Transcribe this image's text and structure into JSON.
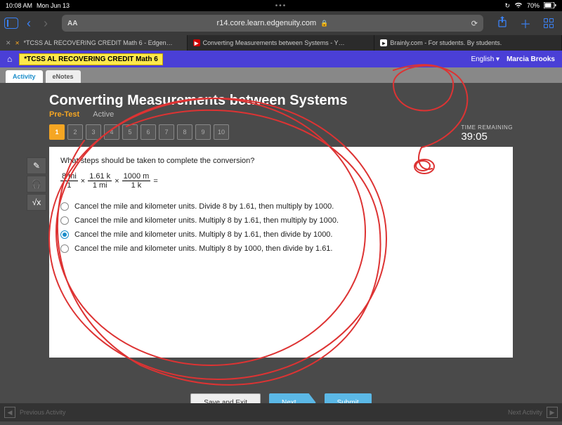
{
  "status": {
    "time": "10:08 AM",
    "date": "Mon Jun 13",
    "battery": "70%"
  },
  "safari": {
    "url": "r14.core.learn.edgenuity.com",
    "aa": "AA"
  },
  "btabs": [
    {
      "label": "*TCSS AL RECOVERING CREDIT Math 6 - Edgen…"
    },
    {
      "label": "Converting Measurements between Systems - Y…"
    },
    {
      "label": "Brainly.com - For students. By students."
    }
  ],
  "header": {
    "crumb": "*TCSS AL RECOVERING CREDIT Math 6",
    "lang": "English",
    "user": "Marcia Brooks"
  },
  "subtabs": {
    "activity": "Activity",
    "enotes": "eNotes"
  },
  "lesson": {
    "title": "Converting Measurements between Systems",
    "section": "Pre-Test",
    "status": "Active",
    "qnums": [
      "1",
      "2",
      "3",
      "4",
      "5",
      "6",
      "7",
      "8",
      "9",
      "10"
    ],
    "current": 0,
    "timer_label": "TIME REMAINING",
    "timer_value": "39:05"
  },
  "question": {
    "prompt": "What steps should be taken to complete the conversion?",
    "frac1_n": "8 mi",
    "frac1_d": "1",
    "frac2_n": "1.61 k",
    "frac2_d": "1 mi",
    "frac3_n": "1000 m",
    "frac3_d": "1 k",
    "equals": "=",
    "times": "×",
    "options": [
      "Cancel the mile and kilometer units. Divide 8 by 1.61, then multiply by 1000.",
      "Cancel the mile and kilometer units. Multiply 8 by 1.61, then multiply by 1000.",
      "Cancel the mile and kilometer units. Multiply 8 by 1.61, then divide by 1000.",
      "Cancel the mile and kilometer units. Multiply 8 by 1000, then divide by 1.61."
    ],
    "selected": 2
  },
  "actions": {
    "save": "Save and Exit",
    "next": "Next",
    "submit": "Submit"
  },
  "botnav": {
    "prev": "Previous Activity",
    "next": "Next Activity"
  }
}
